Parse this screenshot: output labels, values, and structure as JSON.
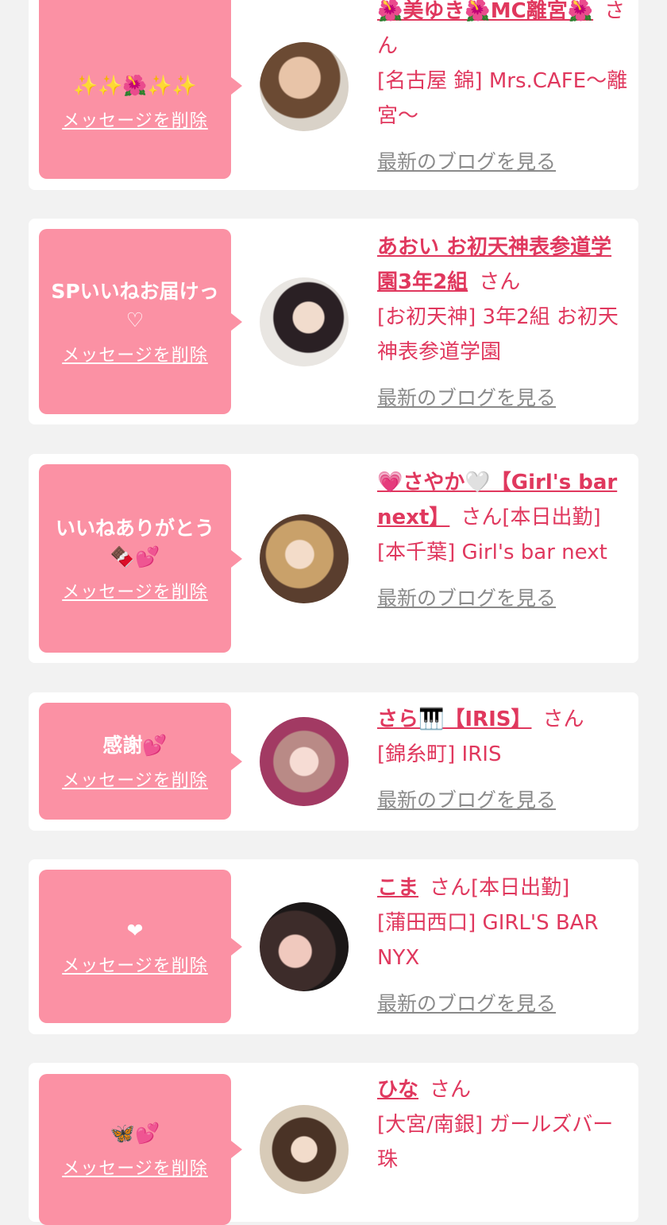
{
  "delete_label": "メッセージを削除",
  "blog_label": "最新のブログを見る",
  "san": "さん",
  "colors": {
    "bubble": "#fb91a4",
    "accent": "#e0385e",
    "link_gray": "#8a8a8a",
    "background": "#f2f2f2"
  },
  "messages": [
    {
      "text": "✨✨🌺✨✨",
      "name": "🌺美ゆき🌺MC離宮🌺",
      "status": "",
      "shop": "[名古屋 錦] Mrs.CAFE〜離宮〜"
    },
    {
      "text": "SPいいねお届けっ♡",
      "name": "あおい お初天神表参道学園3年2組",
      "status": "",
      "shop": "[お初天神] 3年2組 お初天神表参道学園"
    },
    {
      "text": "いいねありがとう🍫💕",
      "name": "💗さやか🤍【Girl's bar next】",
      "status": "[本日出勤]",
      "shop": "[本千葉] Girl's bar next"
    },
    {
      "text": "感謝💕",
      "name": "さら🎹【IRIS】",
      "status": "",
      "shop": "[錦糸町] IRIS"
    },
    {
      "text": "❤",
      "name": "こま",
      "status": "[本日出勤]",
      "shop": "[蒲田西口] GIRL'S BAR NYX"
    },
    {
      "text": "🦋💕",
      "name": "ひな",
      "status": "",
      "shop": "[大宮/南銀] ガールズバー 珠"
    }
  ]
}
